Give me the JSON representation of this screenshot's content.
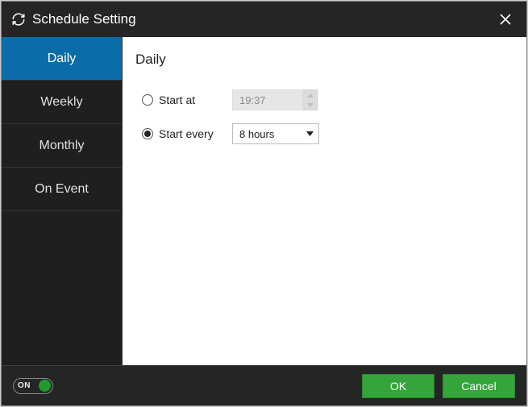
{
  "title": "Schedule Setting",
  "tabs": [
    "Daily",
    "Weekly",
    "Monthly",
    "On Event"
  ],
  "activeTab": 0,
  "panel": {
    "heading": "Daily",
    "mode": "start_every",
    "start_at_label": "Start at",
    "start_at_value": "19:37",
    "start_every_label": "Start every",
    "start_every_value": "8 hours"
  },
  "footer": {
    "toggle_label": "ON",
    "toggle_state": true,
    "ok_label": "OK",
    "cancel_label": "Cancel"
  },
  "colors": {
    "accent": "#0a6ca8",
    "button": "#34a43b"
  }
}
